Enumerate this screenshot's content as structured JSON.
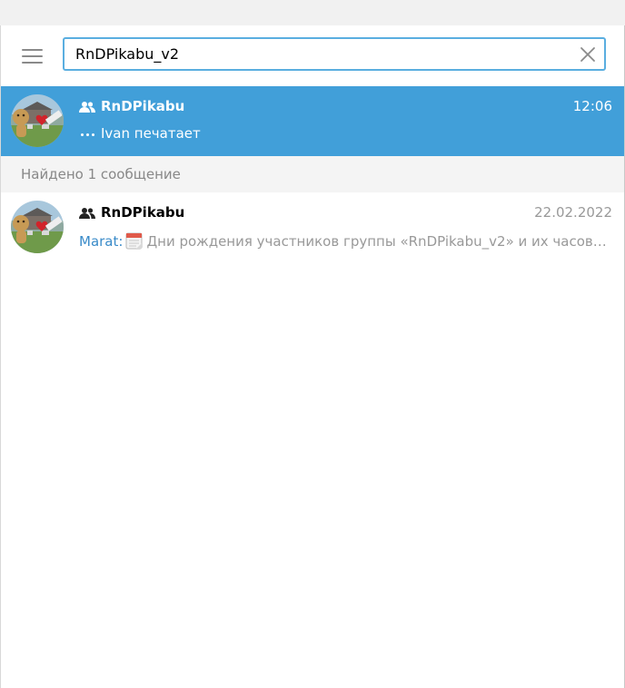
{
  "search": {
    "value": "RnDPikabu_v2"
  },
  "active_chat": {
    "name": "RnDPikabu",
    "time": "12:06",
    "status": "Ivan печатает"
  },
  "results_header": "Найдено 1 сообщение",
  "result_chat": {
    "name": "RnDPikabu",
    "date": "22.02.2022",
    "sender": "Marat:",
    "snippet": "Дни рождения участников группы «RnDPikabu_v2» и их часовы..."
  },
  "icons": {
    "menu": "hamburger-menu-icon",
    "clear": "close-icon",
    "group": "group-icon",
    "typing": "typing-dots-icon",
    "calendar": "calendar-emoji-icon"
  },
  "colors": {
    "accent": "#419fd9",
    "search_border": "#5aaee0",
    "sender": "#3a8bc9",
    "muted": "#999999"
  }
}
